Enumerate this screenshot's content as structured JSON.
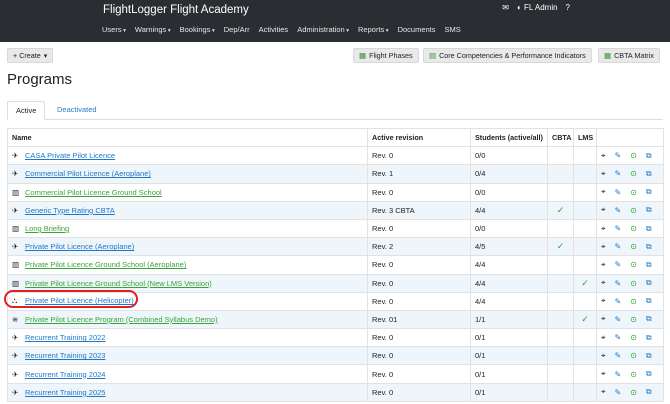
{
  "app": {
    "title": "FlightLogger Flight Academy",
    "user": "FL Admin"
  },
  "nav": [
    {
      "label": "Users",
      "caret": true
    },
    {
      "label": "Warnings",
      "caret": true
    },
    {
      "label": "Bookings",
      "caret": true
    },
    {
      "label": "Dep/Arr",
      "caret": false
    },
    {
      "label": "Activities",
      "caret": false
    },
    {
      "label": "Administration",
      "caret": true
    },
    {
      "label": "Reports",
      "caret": true
    },
    {
      "label": "Documents",
      "caret": false
    },
    {
      "label": "SMS",
      "caret": false
    }
  ],
  "toolbar": {
    "create": "+ Create",
    "flight_phases": "Flight Phases",
    "competencies": "Core Competencies & Performance Indicators",
    "cbta_matrix": "CBTA Matrix"
  },
  "page_title": "Programs",
  "tabs": {
    "active": "Active",
    "deactivated": "Deactivated"
  },
  "columns": {
    "name": "Name",
    "revision": "Active revision",
    "students": "Students (active/all)",
    "cbta": "CBTA",
    "lms": "LMS"
  },
  "programs": [
    {
      "name": "CASA Private Pilot Licence",
      "type": "plane-icon",
      "color": "blue",
      "revision": "Rev. 0",
      "students": "0/0",
      "cbta": false,
      "lms": false
    },
    {
      "name": "Commercial Pilot Licence (Aeroplane)",
      "type": "plane-icon",
      "color": "blue",
      "revision": "Rev. 1",
      "students": "0/4",
      "cbta": false,
      "lms": false
    },
    {
      "name": "Commercial Pilot Licence Ground School",
      "type": "classroom-icon",
      "color": "green",
      "revision": "Rev. 0",
      "students": "0/0",
      "cbta": false,
      "lms": false
    },
    {
      "name": "Generic Type Rating CBTA",
      "type": "plane-icon",
      "color": "blue",
      "revision": "Rev. 3 CBTA",
      "students": "4/4",
      "cbta": true,
      "lms": false
    },
    {
      "name": "Long Briefing",
      "type": "classroom-icon",
      "color": "green",
      "revision": "Rev. 0",
      "students": "0/0",
      "cbta": false,
      "lms": false
    },
    {
      "name": "Private Pilot Licence (Aeroplane)",
      "type": "plane-icon",
      "color": "blue",
      "revision": "Rev. 2",
      "students": "4/5",
      "cbta": true,
      "lms": false
    },
    {
      "name": "Private Pilot Licence Ground School (Aeroplane)",
      "type": "classroom-icon",
      "color": "green",
      "revision": "Rev. 0",
      "students": "4/4",
      "cbta": false,
      "lms": false
    },
    {
      "name": "Private Pilot Licence Ground School (New LMS Version)",
      "type": "classroom-icon",
      "color": "green",
      "revision": "Rev. 0",
      "students": "4/4",
      "cbta": false,
      "lms": true
    },
    {
      "name": "Private Pilot Licence (Helicopter)",
      "type": "helicopter-icon",
      "color": "blue",
      "revision": "Rev. 0",
      "students": "4/4",
      "cbta": false,
      "lms": false
    },
    {
      "name": "Private Pilot Licence Program (Combined Syllabus Demo)",
      "type": "layers-icon",
      "color": "green",
      "revision": "Rev. 01",
      "students": "1/1",
      "cbta": false,
      "lms": true
    },
    {
      "name": "Recurrent Training 2022",
      "type": "plane-icon",
      "color": "blue",
      "revision": "Rev. 0",
      "students": "0/1",
      "cbta": false,
      "lms": false
    },
    {
      "name": "Recurrent Training 2023",
      "type": "plane-icon",
      "color": "blue",
      "revision": "Rev. 0",
      "students": "0/1",
      "cbta": false,
      "lms": false
    },
    {
      "name": "Recurrent Training 2024",
      "type": "plane-icon",
      "color": "blue",
      "revision": "Rev. 0",
      "students": "0/1",
      "cbta": false,
      "lms": false
    },
    {
      "name": "Recurrent Training 2025",
      "type": "plane-icon",
      "color": "blue",
      "revision": "Rev. 0",
      "students": "0/1",
      "cbta": false,
      "lms": false
    }
  ],
  "colors": {
    "topbar": "#2a2d31",
    "link_blue": "#1e78c8",
    "link_green": "#3aa43a",
    "highlight": "#e02020",
    "row_alt": "#eef5fb"
  }
}
